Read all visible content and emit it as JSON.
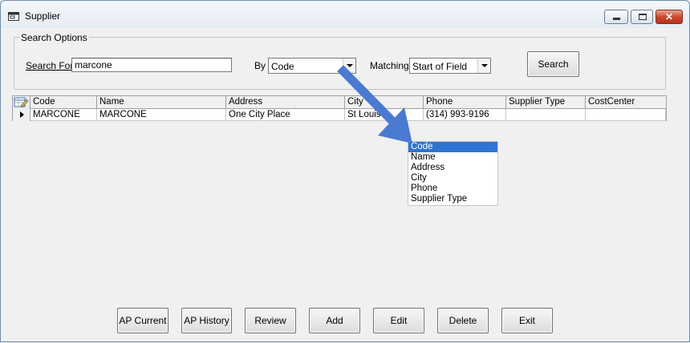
{
  "window": {
    "title": "Supplier",
    "controls": {
      "close_glyph": "✕"
    }
  },
  "search_options": {
    "legend": "Search Options",
    "search_for_label": "Search For",
    "search_for_value": "marcone",
    "by_label": "By",
    "by_value": "Code",
    "matching_label": "Matching",
    "matching_value": "Start of Field",
    "search_button": "Search"
  },
  "grid": {
    "columns": [
      "Code",
      "Name",
      "Address",
      "City",
      "Phone",
      "Supplier Type",
      "CostCenter"
    ],
    "rows": [
      {
        "code": "MARCONE",
        "name": "MARCONE",
        "address": "One City Place",
        "city": "St Louis",
        "phone": "(314) 993-9196",
        "supplier_type": "",
        "cost_center": ""
      }
    ]
  },
  "by_dropdown": {
    "options": [
      "Code",
      "Name",
      "Address",
      "City",
      "Phone",
      "Supplier Type"
    ],
    "selected": "Code"
  },
  "buttons": {
    "ap_current": "AP Current",
    "ap_history": "AP History",
    "review": "Review",
    "add": "Add",
    "edit": "Edit",
    "delete": "Delete",
    "exit": "Exit"
  },
  "colors": {
    "arrow": "#4a7bd0",
    "selection": "#3074d2"
  }
}
